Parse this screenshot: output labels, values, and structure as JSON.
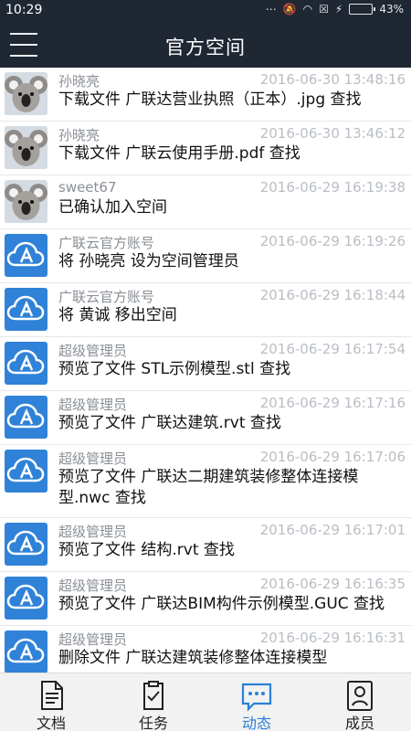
{
  "status_bar": {
    "time": "10:29",
    "battery": "43%",
    "battery_level": 0.43
  },
  "header": {
    "title": "官方空间"
  },
  "feed": [
    {
      "avatar": "koala-avatar",
      "actor": "孙晓亮",
      "time": "2016-06-30 13:48:16",
      "text": "下载文件 广联达营业执照（正本）.jpg 查找"
    },
    {
      "avatar": "koala-avatar",
      "actor": "孙晓亮",
      "time": "2016-06-30 13:46:12",
      "text": "下载文件 广联云使用手册.pdf 查找"
    },
    {
      "avatar": "koala-avatar",
      "actor": "sweet67",
      "time": "2016-06-29 16:19:38",
      "text": "已确认加入空间"
    },
    {
      "avatar": "cloud-logo-avatar",
      "actor": "广联云官方账号",
      "time": "2016-06-29 16:19:26",
      "text": "将 孙晓亮 设为空间管理员"
    },
    {
      "avatar": "cloud-logo-avatar",
      "actor": "广联云官方账号",
      "time": "2016-06-29 16:18:44",
      "text": "将 黄诚 移出空间"
    },
    {
      "avatar": "cloud-logo-avatar",
      "actor": "超级管理员",
      "time": "2016-06-29 16:17:54",
      "text": "预览了文件 STL示例模型.stl 查找"
    },
    {
      "avatar": "cloud-logo-avatar",
      "actor": "超级管理员",
      "time": "2016-06-29 16:17:16",
      "text": "预览了文件 广联达建筑.rvt 查找"
    },
    {
      "avatar": "cloud-logo-avatar",
      "actor": "超级管理员",
      "time": "2016-06-29 16:17:06",
      "text": "预览了文件 广联达二期建筑装修整体连接模型.nwc 查找"
    },
    {
      "avatar": "cloud-logo-avatar",
      "actor": "超级管理员",
      "time": "2016-06-29 16:17:01",
      "text": "预览了文件 结构.rvt 查找"
    },
    {
      "avatar": "cloud-logo-avatar",
      "actor": "超级管理员",
      "time": "2016-06-29 16:16:35",
      "text": "预览了文件 广联达BIM构件示例模型.GUC 查找"
    },
    {
      "avatar": "cloud-logo-avatar",
      "actor": "超级管理员",
      "time": "2016-06-29 16:16:31",
      "text": "删除文件 广联达建筑装修整体连接模型"
    }
  ],
  "tabs": [
    {
      "label": "文档",
      "icon": "document-icon"
    },
    {
      "label": "任务",
      "icon": "clipboard-task-icon"
    },
    {
      "label": "动态",
      "icon": "chat-bubble-icon",
      "active": true
    },
    {
      "label": "成员",
      "icon": "member-icon"
    }
  ],
  "colors": {
    "header_bg": "#1f2733",
    "accent": "#2b7fd8",
    "avatar_blue": "#2f82d7"
  }
}
